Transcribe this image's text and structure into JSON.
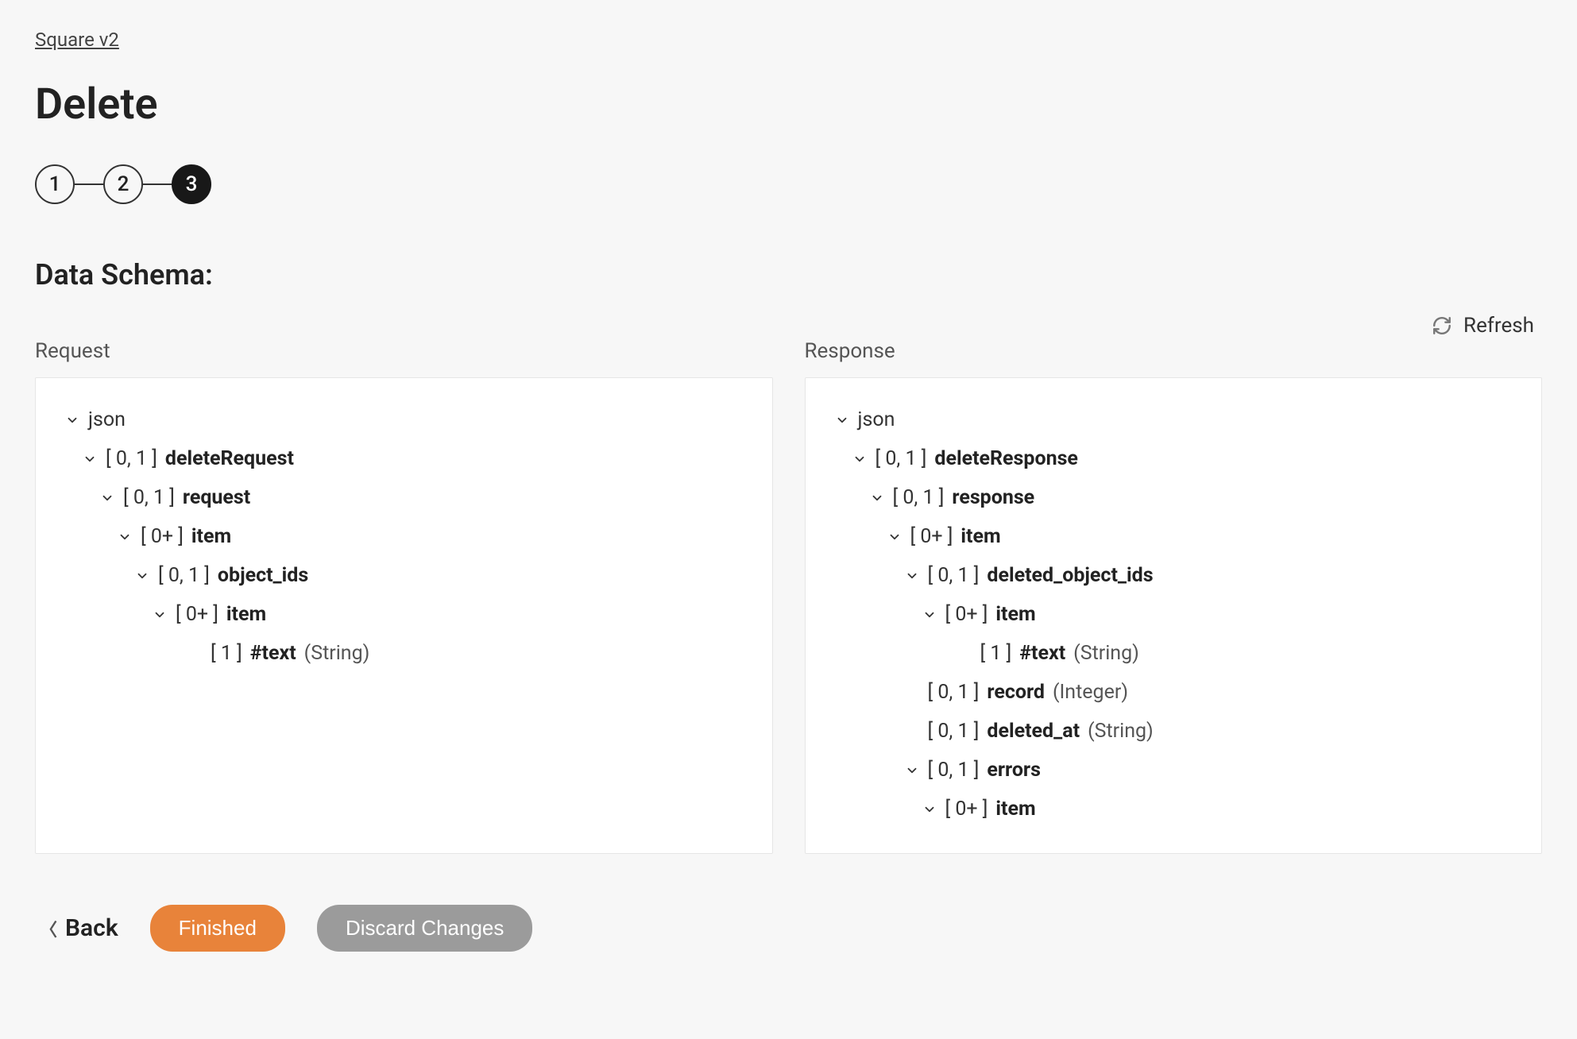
{
  "breadcrumb": "Square v2",
  "title": "Delete",
  "stepper": {
    "steps": [
      "1",
      "2",
      "3"
    ],
    "activeIndex": 2
  },
  "section": "Data Schema:",
  "refresh_label": "Refresh",
  "columns": {
    "request_label": "Request",
    "response_label": "Response"
  },
  "request_tree": [
    {
      "indent": 0,
      "chevron": true,
      "card": "",
      "name": "json",
      "bold": false,
      "type": ""
    },
    {
      "indent": 1,
      "chevron": true,
      "card": "[ 0, 1 ]",
      "name": "deleteRequest",
      "bold": true,
      "type": ""
    },
    {
      "indent": 2,
      "chevron": true,
      "card": "[ 0, 1 ]",
      "name": "request",
      "bold": true,
      "type": ""
    },
    {
      "indent": 3,
      "chevron": true,
      "card": "[ 0+ ]",
      "name": "item",
      "bold": true,
      "type": ""
    },
    {
      "indent": 4,
      "chevron": true,
      "card": "[ 0, 1 ]",
      "name": "object_ids",
      "bold": true,
      "type": ""
    },
    {
      "indent": 5,
      "chevron": true,
      "card": "[ 0+ ]",
      "name": "item",
      "bold": true,
      "type": ""
    },
    {
      "indent": 6,
      "chevron": false,
      "card": "[ 1 ]",
      "name": "#text",
      "bold": true,
      "type": "(String)"
    }
  ],
  "response_tree": [
    {
      "indent": 0,
      "chevron": true,
      "card": "",
      "name": "json",
      "bold": false,
      "type": ""
    },
    {
      "indent": 1,
      "chevron": true,
      "card": "[ 0, 1 ]",
      "name": "deleteResponse",
      "bold": true,
      "type": ""
    },
    {
      "indent": 2,
      "chevron": true,
      "card": "[ 0, 1 ]",
      "name": "response",
      "bold": true,
      "type": ""
    },
    {
      "indent": 3,
      "chevron": true,
      "card": "[ 0+ ]",
      "name": "item",
      "bold": true,
      "type": ""
    },
    {
      "indent": 4,
      "chevron": true,
      "card": "[ 0, 1 ]",
      "name": "deleted_object_ids",
      "bold": true,
      "type": ""
    },
    {
      "indent": 5,
      "chevron": true,
      "card": "[ 0+ ]",
      "name": "item",
      "bold": true,
      "type": ""
    },
    {
      "indent": 6,
      "chevron": false,
      "card": "[ 1 ]",
      "name": "#text",
      "bold": true,
      "type": "(String)"
    },
    {
      "indent": 4,
      "chevron": false,
      "card": "[ 0, 1 ]",
      "name": "record",
      "bold": true,
      "type": "(Integer)"
    },
    {
      "indent": 4,
      "chevron": false,
      "card": "[ 0, 1 ]",
      "name": "deleted_at",
      "bold": true,
      "type": "(String)"
    },
    {
      "indent": 4,
      "chevron": true,
      "card": "[ 0, 1 ]",
      "name": "errors",
      "bold": true,
      "type": ""
    },
    {
      "indent": 5,
      "chevron": true,
      "card": "[ 0+ ]",
      "name": "item",
      "bold": true,
      "type": ""
    }
  ],
  "footer": {
    "back": "Back",
    "finished": "Finished",
    "discard": "Discard Changes"
  }
}
